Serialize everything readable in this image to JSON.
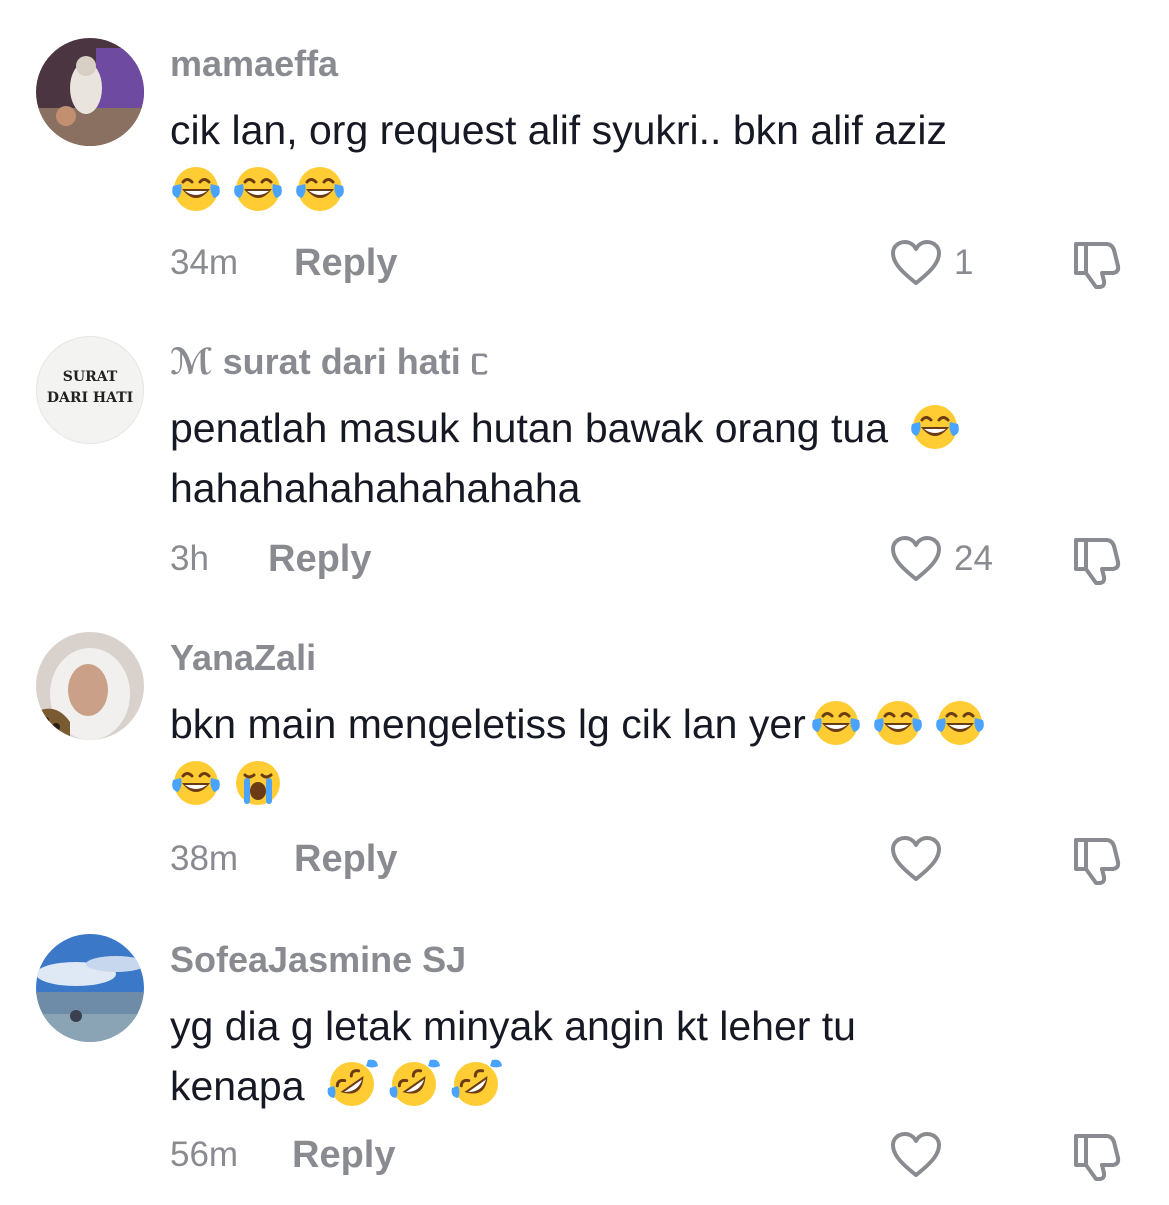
{
  "comments": [
    {
      "username": "mamaeffa",
      "text": "cik lan, org request alif syukri.. bkn alif aziz",
      "emojis": [
        "joy",
        "joy",
        "joy"
      ],
      "time": "34m",
      "reply_label": "Reply",
      "likes": "1"
    },
    {
      "username": "surat dari hati",
      "username_prefix": "ℳ",
      "username_suffix": "ᥴ",
      "avatar_text_line1": "SURAT",
      "avatar_text_line2": "DARI HATI",
      "text": "penatlah masuk hutan bawak orang tua",
      "text_line2": "hahahahahahahahaha",
      "emojis": [
        "joy"
      ],
      "time": "3h",
      "reply_label": "Reply",
      "likes": "24"
    },
    {
      "username": "YanaZali",
      "text": "bkn main mengeletiss lg cik lan yer",
      "emojis": [
        "joy",
        "joy",
        "joy",
        "joy",
        "sob"
      ],
      "time": "38m",
      "reply_label": "Reply",
      "likes": ""
    },
    {
      "username": "SofeaJasmine SJ",
      "text": "yg dia g letak minyak angin kt leher tu",
      "text_line2": "kenapa",
      "emojis": [
        "rofl",
        "rofl",
        "rofl"
      ],
      "time": "56m",
      "reply_label": "Reply",
      "likes": ""
    }
  ],
  "icons": {
    "like": "heart-outline-icon",
    "dislike": "thumbs-down-icon",
    "emoji_joy": "face-with-tears-of-joy",
    "emoji_sob": "loudly-crying-face",
    "emoji_rofl": "rolling-on-floor-laughing"
  },
  "colors": {
    "text": "#161823",
    "secondary": "#8a8b91",
    "emoji_yellow": "#ffcc33",
    "tear_blue": "#4aa3ff"
  }
}
